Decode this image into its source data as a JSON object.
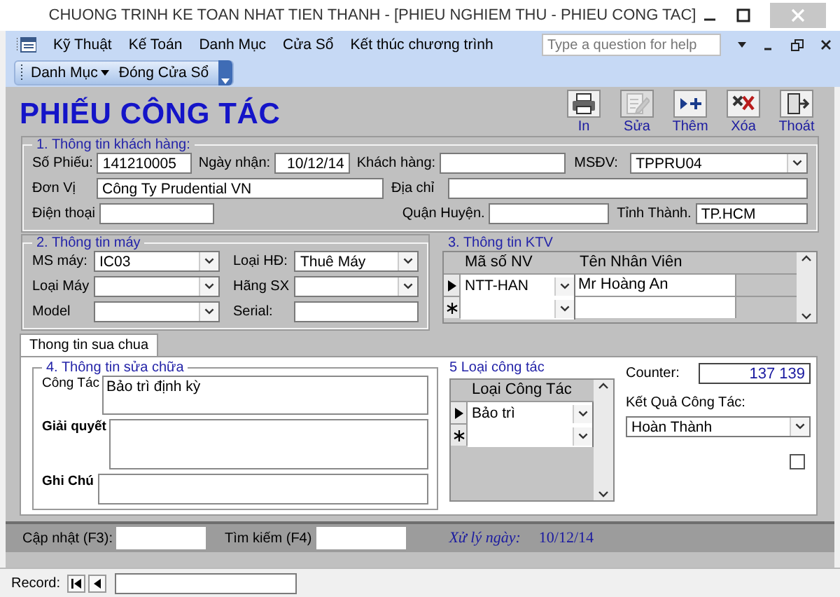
{
  "window": {
    "title": "CHUONG TRINH KE TOAN NHAT TIEN THANH - [PHIEU NGHIEM THU - PHIEU CONG TAC]"
  },
  "menu": [
    {
      "label": "Kỹ Thuật"
    },
    {
      "label": "Kế Toán"
    },
    {
      "label": "Danh Mục"
    },
    {
      "label": "Cửa Sổ"
    },
    {
      "label": "Kết thúc chương trình"
    }
  ],
  "help_box": {
    "placeholder": "Type a question for help"
  },
  "toolbar": [
    {
      "label": "Danh Mục",
      "kind": "dropdown"
    },
    {
      "label": "Đóng Cửa Sổ",
      "kind": "button"
    }
  ],
  "form": {
    "title": "PHIẾU CÔNG TÁC",
    "actions": [
      {
        "label": "In",
        "disabled": false
      },
      {
        "label": "Sửa",
        "disabled": true
      },
      {
        "label": "Thêm",
        "disabled": false
      },
      {
        "label": "Xóa",
        "disabled": false
      },
      {
        "label": "Thoát",
        "disabled": false
      }
    ],
    "customer": {
      "legend": "1. Thông tin khách hàng:",
      "fields": [
        {
          "label": "Số Phiếu:",
          "kind": "text",
          "value": "141210005"
        },
        {
          "label": "Ngày nhận:",
          "kind": "date",
          "value": "10/12/14"
        },
        {
          "label": "Khách hàng:",
          "kind": "text"
        },
        {
          "label": "MSĐV:",
          "kind": "combo",
          "value": "TPPRU04"
        },
        {
          "label": "Đơn Vị",
          "kind": "text",
          "value": "Công Ty Prudential VN"
        },
        {
          "label": "Địa chỉ",
          "kind": "text"
        },
        {
          "label": "Điện thoại",
          "kind": "text"
        },
        {
          "label": "Quận Huyện.",
          "kind": "text"
        },
        {
          "label": "Tỉnh Thành.",
          "kind": "text",
          "value": "TP.HCM"
        }
      ]
    },
    "machine": {
      "legend": "2. Thông tin máy",
      "rows": [
        [
          {
            "label": "MS máy:",
            "kind": "combo",
            "value": "IC03"
          },
          {
            "label": "Loại HĐ:",
            "kind": "combo",
            "value": "Thuê Máy"
          }
        ],
        [
          {
            "label": "Loại Máy",
            "kind": "combo"
          },
          {
            "label": "Hãng SX",
            "kind": "combo"
          }
        ],
        [
          {
            "label": "Model",
            "kind": "combo"
          },
          {
            "label": "Serial:",
            "kind": "text"
          }
        ]
      ]
    },
    "technicians": {
      "legend": "3. Thông tin KTV",
      "columns": [
        {
          "label": "Mã số NV",
          "kind": "combo"
        },
        {
          "label": "Tên Nhân Viên",
          "kind": "text"
        }
      ],
      "rows": [
        {
          "kind": "current",
          "cells": [
            "NTT-HAN",
            "Mr Hoàng An"
          ]
        },
        {
          "kind": "new"
        }
      ]
    },
    "tabs": [
      {
        "label": "Thong tin sua chua",
        "selected": true
      }
    ],
    "repair": {
      "legend": "4. Thông tin sửa chữa",
      "fields": [
        {
          "label": "Công Tác",
          "value": "Bảo trì định kỳ"
        },
        {
          "label": "Giải quyết"
        },
        {
          "label": "Ghi Chú"
        }
      ]
    },
    "work_types": {
      "legend": "5 Loại công tác",
      "columns": [
        {
          "label": "Loại Công Tác",
          "kind": "combo"
        }
      ],
      "rows": [
        {
          "kind": "current",
          "cells": [
            "Bảo trì"
          ]
        },
        {
          "kind": "new"
        }
      ]
    },
    "counter": {
      "label": "Counter:",
      "value": "137 139"
    },
    "result": {
      "label": "Kết Quả Công Tác:",
      "kind": "combo",
      "value": "Hoàn Thành"
    },
    "flag": {
      "checked": false
    },
    "status": {
      "update": {
        "label": "Cập nhật (F3):"
      },
      "search": {
        "label": "Tìm kiếm (F4)"
      },
      "processed": {
        "label": "Xử lý ngày:",
        "value": "10/12/14"
      }
    },
    "record_nav": {
      "label": "Record:"
    }
  }
}
